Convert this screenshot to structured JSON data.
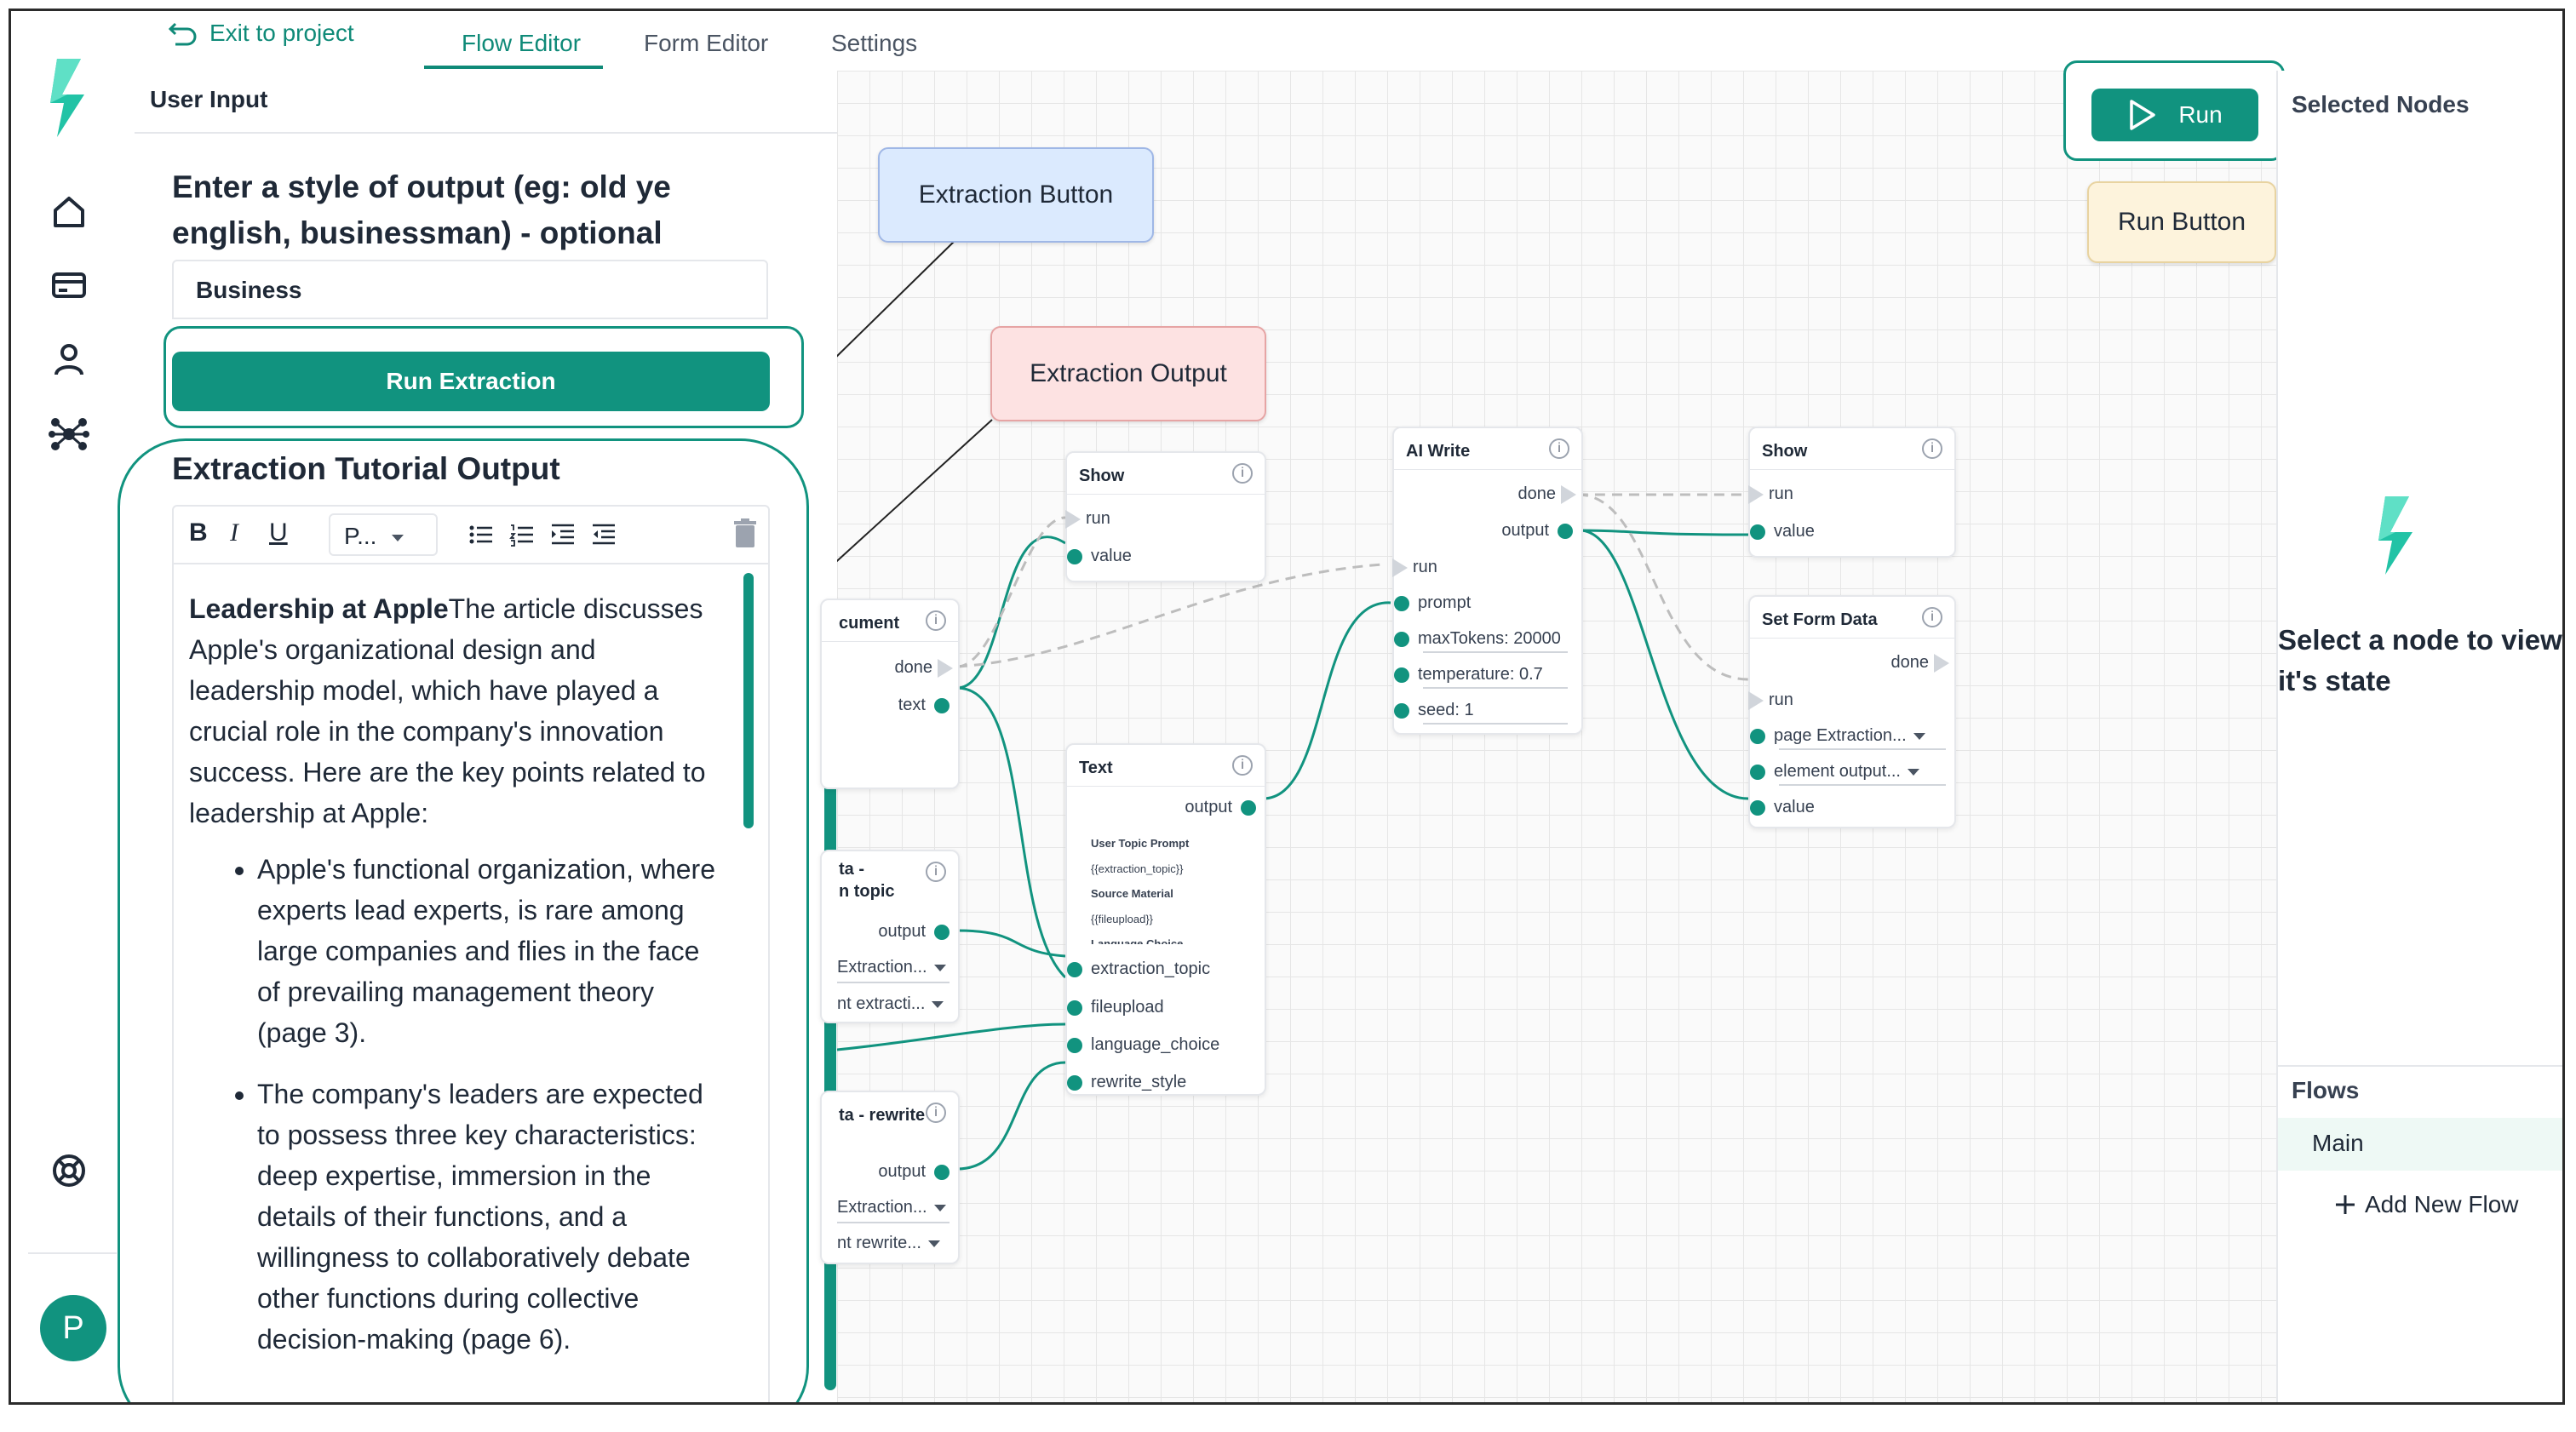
{
  "topbar": {
    "exit_label": "Exit to project",
    "tabs": [
      {
        "label": "Flow Editor",
        "active": true
      },
      {
        "label": "Form Editor",
        "active": false
      },
      {
        "label": "Settings",
        "active": false
      }
    ]
  },
  "sidebar": {
    "icons": [
      "logo-icon",
      "home-icon",
      "card-icon",
      "user-icon",
      "network-icon",
      "help-icon"
    ],
    "avatar_initial": "P"
  },
  "form": {
    "section_title": "User Input",
    "question": "Enter a style of output (eg: old ye english, businessman) - optional",
    "input_value": "Business",
    "run_button": "Run Extraction",
    "output_title": "Extraction Tutorial Output",
    "toolbar": {
      "bold": "B",
      "italic": "I",
      "underline": "U",
      "paragraph": "P..."
    },
    "content": {
      "heading": "Leadership at Apple",
      "intro": "The article discusses Apple's organizational design and leadership model, which have played a crucial role in the company's innovation success. Here are the key points related to leadership at Apple:",
      "bullets": [
        "Apple's functional organization, where experts lead experts, is rare among large companies and flies in the face of prevailing management theory (page 3).",
        "The company's leaders are expected to possess three key characteristics: deep expertise, immersion in the details of their functions, and a willingness to collaboratively debate other functions during collective decision-making (page 6)."
      ]
    }
  },
  "annotations": {
    "extraction_button": "Extraction Button",
    "extraction_output": "Extraction Output",
    "run_button": "Run Button"
  },
  "canvas": {
    "nodes": {
      "document": {
        "title": "cument",
        "ports": [
          "done",
          "text"
        ]
      },
      "extraction_topic": {
        "title_line1": "ta -",
        "title_line2": "n topic",
        "ports": [
          "output",
          "Extraction...",
          "nt extracti..."
        ]
      },
      "rewrite": {
        "title": "ta - rewrite",
        "ports": [
          "output",
          "Extraction...",
          "nt rewrite..."
        ]
      },
      "show1": {
        "title": "Show",
        "ports": [
          "run",
          "value"
        ]
      },
      "text": {
        "title": "Text",
        "output": "output",
        "preview": [
          "User Topic Prompt",
          "{{extraction_topic}}",
          "Source Material",
          "{{fileupload}}",
          "Language Choice"
        ],
        "ports": [
          "extraction_topic",
          "fileupload",
          "language_choice",
          "rewrite_style"
        ]
      },
      "ai_write": {
        "title": "AI Write",
        "ports": [
          "done",
          "output",
          "run",
          "prompt",
          "maxTokens: 20000",
          "temperature: 0.7",
          "seed: 1"
        ]
      },
      "show2": {
        "title": "Show",
        "ports": [
          "run",
          "value"
        ]
      },
      "set_form_data": {
        "title": "Set Form Data",
        "ports": [
          "done",
          "run",
          "page Extraction...",
          "element output...",
          "value"
        ]
      }
    }
  },
  "right_panel": {
    "run_label": "Run",
    "selected_nodes_title": "Selected Nodes",
    "empty_state": "Select a node to view it's state",
    "flows_title": "Flows",
    "flows": [
      "Main"
    ],
    "add_flow": "Add New Flow"
  },
  "colors": {
    "accent": "#11937f",
    "note_blue": "#dbeafe",
    "note_red": "#fde2e2",
    "note_yellow": "#fdf3dc"
  }
}
